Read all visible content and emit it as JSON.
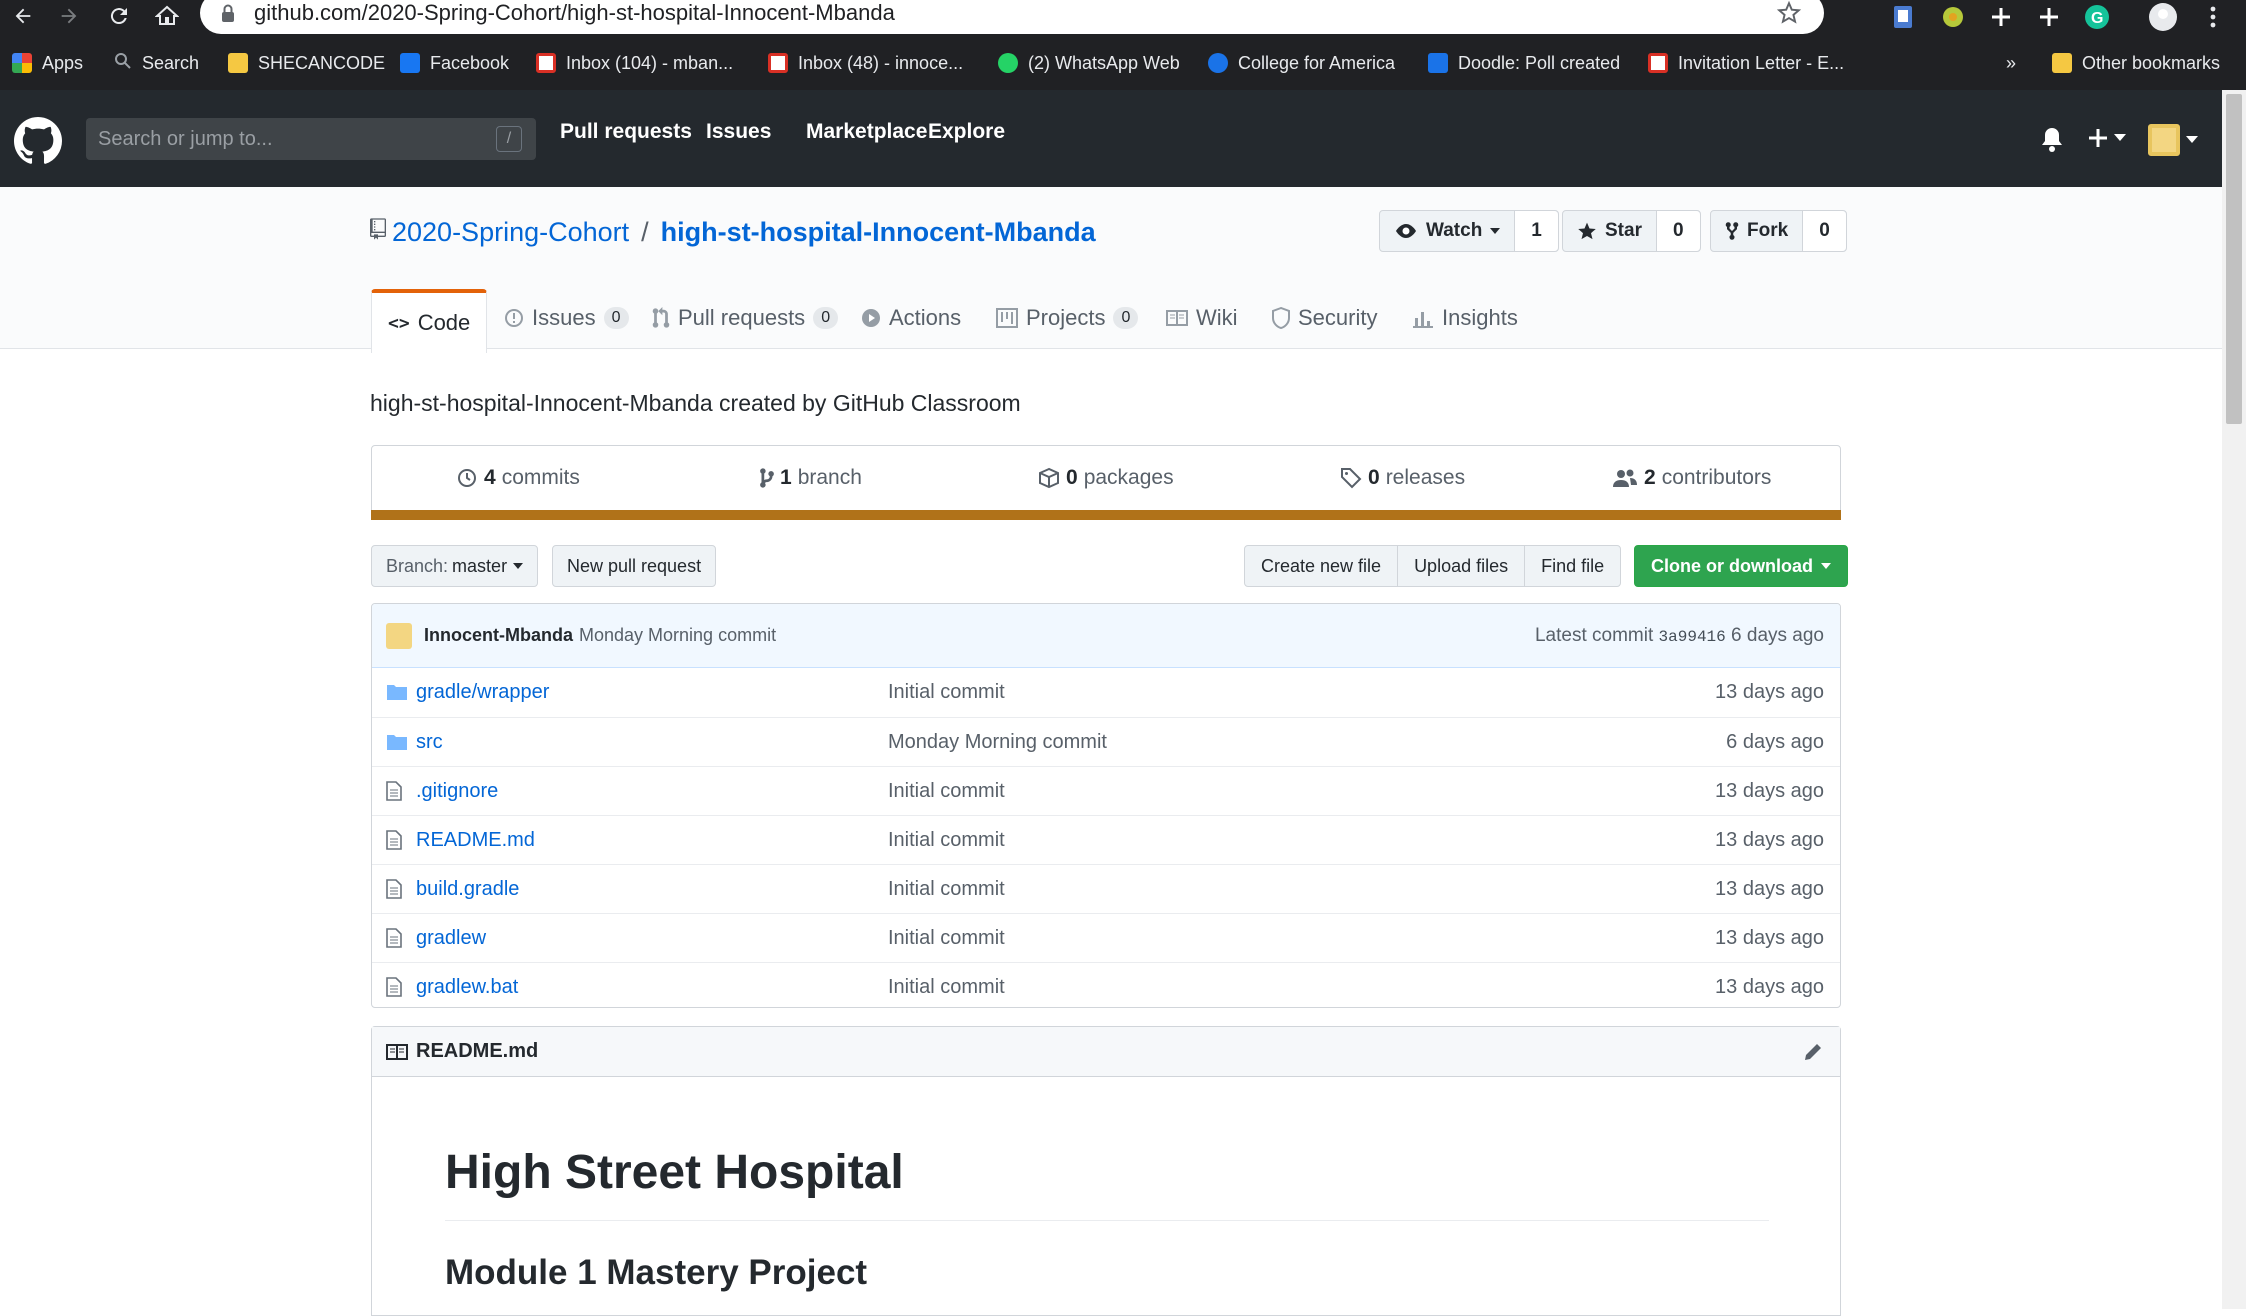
{
  "browser": {
    "url": "github.com/2020-Spring-Cohort/high-st-hospital-Innocent-Mbanda",
    "bookmarks": [
      {
        "label": "Apps",
        "color": "#ea4335"
      },
      {
        "label": "Search",
        "color": "#9aa0a6"
      },
      {
        "label": "SHECANCODE",
        "color": "#f5c842"
      },
      {
        "label": "Facebook",
        "color": "#1877f2"
      },
      {
        "label": "Inbox (104) - mban...",
        "color": "#d93025"
      },
      {
        "label": "Inbox (48) - innoce...",
        "color": "#d93025"
      },
      {
        "label": "(2) WhatsApp Web",
        "color": "#25d366"
      },
      {
        "label": "College for America",
        "color": "#1a73e8"
      },
      {
        "label": "Doodle: Poll created",
        "color": "#1a73e8"
      },
      {
        "label": "Invitation Letter - E...",
        "color": "#d93025"
      }
    ],
    "more": "»",
    "other_bookmarks": "Other bookmarks"
  },
  "header": {
    "search_placeholder": "Search or jump to...",
    "slash": "/",
    "nav": [
      "Pull requests",
      "Issues",
      "Marketplace",
      "Explore"
    ]
  },
  "repo": {
    "owner": "2020-Spring-Cohort",
    "separator": "/",
    "name": "high-st-hospital-Innocent-Mbanda",
    "watch_label": "Watch",
    "watch_count": "1",
    "star_label": "Star",
    "star_count": "0",
    "fork_label": "Fork",
    "fork_count": "0",
    "tabs": [
      {
        "label": "Code",
        "counter": ""
      },
      {
        "label": "Issues",
        "counter": "0"
      },
      {
        "label": "Pull requests",
        "counter": "0"
      },
      {
        "label": "Actions",
        "counter": ""
      },
      {
        "label": "Projects",
        "counter": "0"
      },
      {
        "label": "Wiki",
        "counter": ""
      },
      {
        "label": "Security",
        "counter": ""
      },
      {
        "label": "Insights",
        "counter": ""
      }
    ],
    "description": "high-st-hospital-Innocent-Mbanda created by GitHub Classroom",
    "summary": {
      "commits_n": "4",
      "commits_label": "commits",
      "branch_n": "1",
      "branch_label": "branch",
      "packages_n": "0",
      "packages_label": "packages",
      "releases_n": "0",
      "releases_label": "releases",
      "contributors_n": "2",
      "contributors_label": "contributors",
      "language_color": "#b07219"
    },
    "branch_prefix": "Branch:",
    "branch_name": "master",
    "new_pr": "New pull request",
    "create_file": "Create new file",
    "upload_files": "Upload files",
    "find_file": "Find file",
    "clone": "Clone or download",
    "latest_commit": {
      "author": "Innocent-Mbanda",
      "message": "Monday Morning commit",
      "prefix": "Latest commit",
      "sha": "3a99416",
      "age": "6 days ago"
    },
    "files": [
      {
        "type": "dir",
        "name_pre": "gradle/",
        "name": "wrapper",
        "commit": "Initial commit",
        "age": "13 days ago"
      },
      {
        "type": "dir",
        "name_pre": "",
        "name": "src",
        "commit": "Monday Morning commit",
        "age": "6 days ago"
      },
      {
        "type": "file",
        "name_pre": "",
        "name": ".gitignore",
        "commit": "Initial commit",
        "age": "13 days ago"
      },
      {
        "type": "file",
        "name_pre": "",
        "name": "README.md",
        "commit": "Initial commit",
        "age": "13 days ago"
      },
      {
        "type": "file",
        "name_pre": "",
        "name": "build.gradle",
        "commit": "Initial commit",
        "age": "13 days ago"
      },
      {
        "type": "file",
        "name_pre": "",
        "name": "gradlew",
        "commit": "Initial commit",
        "age": "13 days ago"
      },
      {
        "type": "file",
        "name_pre": "",
        "name": "gradlew.bat",
        "commit": "Initial commit",
        "age": "13 days ago"
      }
    ],
    "readme": {
      "filename": "README.md",
      "h1": "High Street Hospital",
      "h2": "Module 1 Mastery Project"
    }
  }
}
